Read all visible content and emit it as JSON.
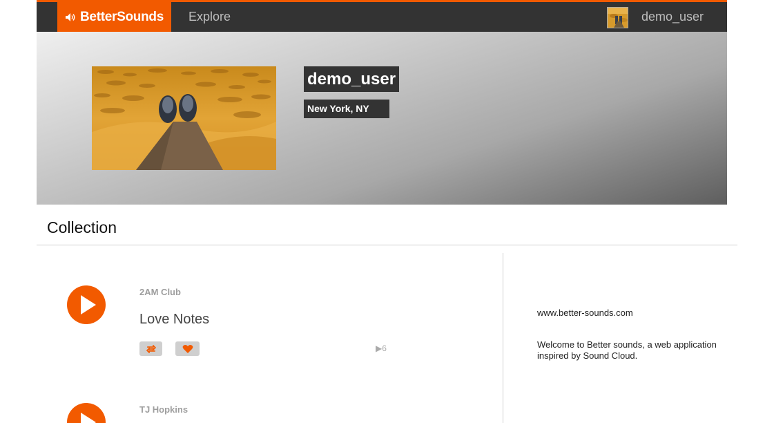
{
  "nav": {
    "brand": "BetterSounds",
    "explore": "Explore",
    "username": "demo_user"
  },
  "profile": {
    "name": "demo_user",
    "location": "New York, NY"
  },
  "collection": {
    "title": "Collection",
    "tracks": [
      {
        "artist": "2AM Club",
        "title": "Love Notes",
        "plays": "6"
      },
      {
        "artist": "TJ Hopkins"
      }
    ]
  },
  "sidebar": {
    "url": "www.better-sounds.com",
    "description": "Welcome to Better sounds, a web application inspired by Sound Cloud."
  },
  "colors": {
    "accent": "#f25a00",
    "nav_bg": "#333333",
    "button_gray": "#cfcfcf"
  },
  "icons": [
    "speaker-icon",
    "play-icon",
    "repost-icon",
    "heart-icon",
    "play-count-icon"
  ]
}
